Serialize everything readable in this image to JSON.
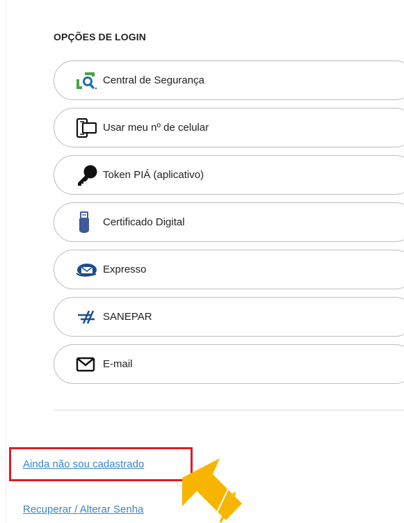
{
  "section": {
    "title": "OPÇÕES DE LOGIN"
  },
  "options": [
    {
      "label": "Central de Segurança",
      "icon": "security-center-icon"
    },
    {
      "label": "Usar meu nº de celular",
      "icon": "mobile-phone-icon"
    },
    {
      "label": "Token PIÁ (aplicativo)",
      "icon": "key-icon"
    },
    {
      "label": "Certificado Digital",
      "icon": "usb-token-icon"
    },
    {
      "label": "Expresso",
      "icon": "expresso-mail-icon"
    },
    {
      "label": "SANEPAR",
      "icon": "sanepar-logo-icon"
    },
    {
      "label": "E-mail",
      "icon": "envelope-icon"
    }
  ],
  "links": {
    "signup": "Ainda não sou cadastrado",
    "recover": "Recuperar / Alterar Senha"
  },
  "colors": {
    "link": "#3a86c8",
    "highlight": "#e01b24",
    "arrow": "#f7b500",
    "security_green": "#45a443",
    "security_blue": "#1f6fa6",
    "expresso_blue": "#1a4d8c",
    "usb_blue": "#3d5a99"
  }
}
